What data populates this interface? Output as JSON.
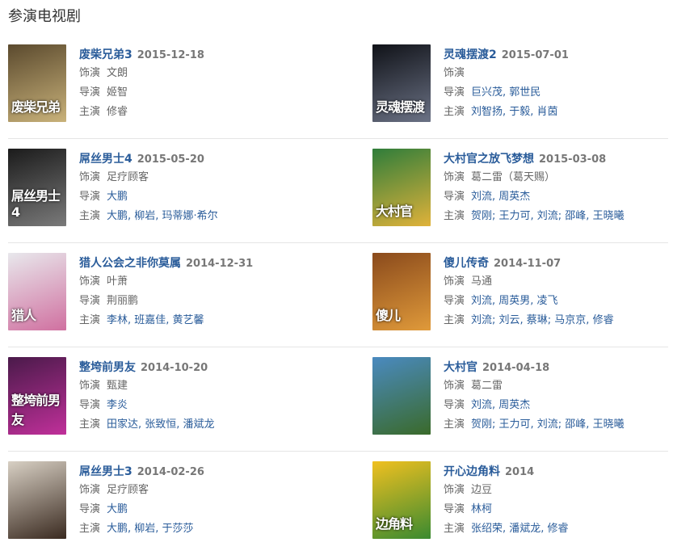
{
  "section_title": "参演电视剧",
  "labels": {
    "role": "饰演",
    "director": "导演",
    "cast": "主演"
  },
  "items": [
    {
      "title": "废柴兄弟3",
      "date": "2015-12-18",
      "poster_text": "废柴兄弟",
      "poster_colors": [
        "#5b4a2e",
        "#c9b27a"
      ],
      "role": "文朗",
      "director": "姬智",
      "cast": "修睿",
      "links": []
    },
    {
      "title": "灵魂摆渡2",
      "date": "2015-07-01",
      "poster_text": "灵魂摆渡",
      "poster_colors": [
        "#101218",
        "#6b7285"
      ],
      "role": "",
      "director": "巨兴茂, 郭世民",
      "cast": "刘智扬, 于毅, 肖茵",
      "links": [
        "director",
        "cast"
      ]
    },
    {
      "title": "屌丝男士4",
      "date": "2015-05-20",
      "poster_text": "屌丝男士4",
      "poster_colors": [
        "#1b1b1b",
        "#7a7a7a"
      ],
      "role": "足疗顾客",
      "director": "大鹏",
      "cast": "大鹏, 柳岩, 玛蒂娜·希尔",
      "links": [
        "director",
        "cast"
      ]
    },
    {
      "title": "大村官之放飞梦想",
      "date": "2015-03-08",
      "poster_text": "大村官",
      "poster_colors": [
        "#2f7d3a",
        "#e0b23a"
      ],
      "role": "葛二雷（葛天赐）",
      "director": "刘流, 周英杰",
      "cast": "贺刚; 王力可, 刘流; 邵峰, 王晓曦",
      "links": [
        "director",
        "cast"
      ]
    },
    {
      "title": "猎人公会之非你莫属",
      "date": "2014-12-31",
      "poster_text": "猎人",
      "poster_colors": [
        "#e8e8ec",
        "#d070a0"
      ],
      "role": "叶萧",
      "director": "荆丽鹏",
      "cast": "李林, 班嘉佳, 黄艺馨",
      "links": [
        "cast"
      ]
    },
    {
      "title": "傻儿传奇",
      "date": "2014-11-07",
      "poster_text": "傻儿",
      "poster_colors": [
        "#8a4a1c",
        "#e09a3a"
      ],
      "role": "马通",
      "director": "刘流, 周英男, 凌飞",
      "cast": "刘流; 刘云, 蔡琳; 马京京, 修睿",
      "links": [
        "director",
        "cast"
      ]
    },
    {
      "title": "整垮前男友",
      "date": "2014-10-20",
      "poster_text": "整垮前男友",
      "poster_colors": [
        "#4a1a4a",
        "#c0309a"
      ],
      "role": "甄建",
      "director": "李炎",
      "cast": "田家达, 张致恒, 潘斌龙",
      "links": [
        "director",
        "cast"
      ]
    },
    {
      "title": "大村官",
      "date": "2014-04-18",
      "poster_text": "",
      "poster_colors": [
        "#4a8ac0",
        "#3a6a2a"
      ],
      "role": "葛二雷",
      "director": "刘流, 周英杰",
      "cast": "贺刚; 王力可, 刘流; 邵峰, 王晓曦",
      "links": [
        "director",
        "cast"
      ]
    },
    {
      "title": "屌丝男士3",
      "date": "2014-02-26",
      "poster_text": "",
      "poster_colors": [
        "#d8d0c4",
        "#3a2a20"
      ],
      "role": "足疗顾客",
      "director": "大鹏",
      "cast": "大鹏, 柳岩, 于莎莎",
      "links": [
        "director",
        "cast"
      ]
    },
    {
      "title": "开心边角料",
      "date": "2014",
      "poster_text": "边角料",
      "poster_colors": [
        "#f0c020",
        "#3a8a30"
      ],
      "role": "边豆",
      "director": "林柯",
      "cast": "张绍荣, 潘斌龙, 修睿",
      "links": [
        "director",
        "cast"
      ]
    }
  ]
}
